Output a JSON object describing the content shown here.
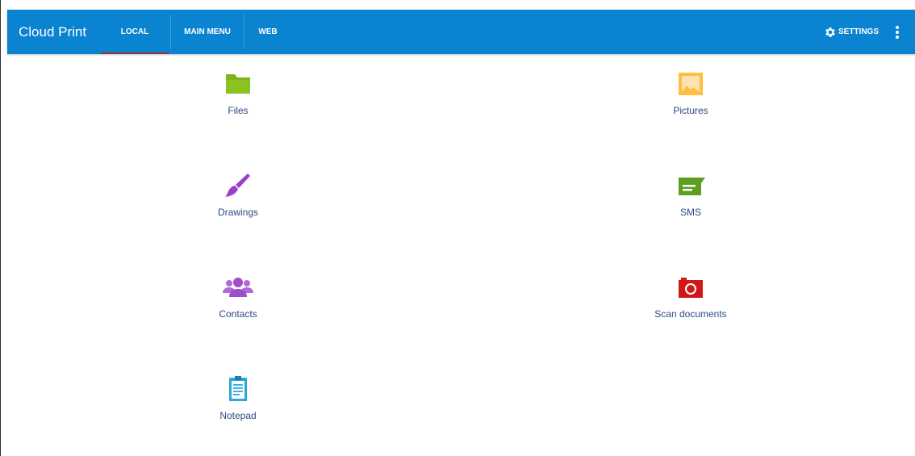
{
  "appbar": {
    "title": "Cloud Print",
    "tabs": [
      {
        "label": "LOCAL",
        "active": true
      },
      {
        "label": "MAIN MENU",
        "active": false
      },
      {
        "label": "WEB",
        "active": false
      }
    ],
    "settings_label": "SETTINGS",
    "settings_icon": "gear-icon",
    "overflow_icon": "more-vert-icon",
    "background_color": "#0a83d0"
  },
  "tiles": [
    {
      "label": "Files",
      "icon": "folder-icon",
      "color": "#8bc21f"
    },
    {
      "label": "Pictures",
      "icon": "image-icon",
      "color": "#ffbe3d"
    },
    {
      "label": "Drawings",
      "icon": "paintbrush-icon",
      "color": "#9c3fcf"
    },
    {
      "label": "SMS",
      "icon": "message-icon",
      "color": "#5e9e1f"
    },
    {
      "label": "Contacts",
      "icon": "contacts-icon",
      "color": "#b06ad6"
    },
    {
      "label": "Scan documents",
      "icon": "camera-icon",
      "color": "#d01818"
    },
    {
      "label": "Notepad",
      "icon": "clipboard-icon",
      "color": "#2aa7dd"
    }
  ]
}
